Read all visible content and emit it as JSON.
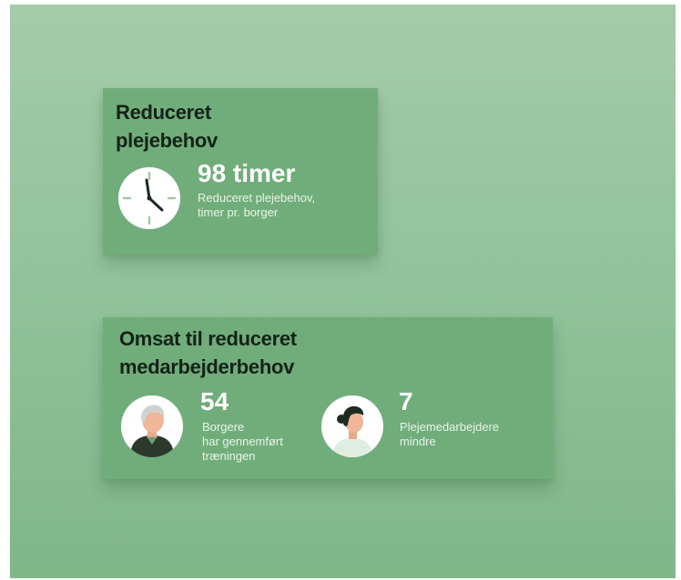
{
  "card_time": {
    "title_lines": [
      "Reduceret",
      "plejebehov"
    ],
    "icon": "clock-icon",
    "value": "98 timer",
    "desc_lines": [
      "Reduceret plejebehov,",
      "timer pr. borger"
    ]
  },
  "card_staff": {
    "title_lines": [
      "Omsat til reduceret",
      "medarbejderbehov"
    ],
    "stats": [
      {
        "icon": "elderly-citizen-avatar-icon",
        "value": "54",
        "desc_lines": [
          "Borgere",
          "har gennemført",
          "træningen"
        ]
      },
      {
        "icon": "care-worker-avatar-icon",
        "value": "7",
        "desc_lines": [
          "Plejemedarbejdere",
          "mindre"
        ]
      }
    ]
  },
  "colors": {
    "background_top": "#a5cba9",
    "background_bottom": "#7fb788",
    "card": "#70ad7a",
    "title_text": "#142217",
    "value_text": "#ffffff"
  }
}
